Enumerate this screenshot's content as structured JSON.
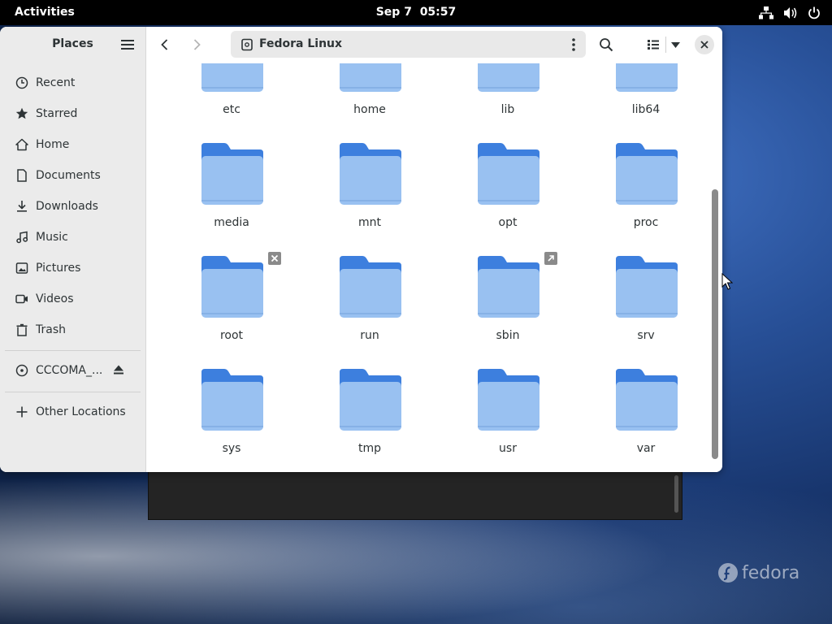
{
  "topbar": {
    "activities": "Activities",
    "date": "Sep 7",
    "time": "05:57",
    "icons": [
      "network-icon",
      "volume-icon",
      "power-icon"
    ]
  },
  "sidebar": {
    "title": "Places",
    "items": [
      {
        "label": "Recent",
        "icon": "clock-icon"
      },
      {
        "label": "Starred",
        "icon": "star-icon"
      },
      {
        "label": "Home",
        "icon": "home-icon"
      },
      {
        "label": "Documents",
        "icon": "document-icon"
      },
      {
        "label": "Downloads",
        "icon": "download-icon"
      },
      {
        "label": "Music",
        "icon": "music-icon"
      },
      {
        "label": "Pictures",
        "icon": "picture-icon"
      },
      {
        "label": "Videos",
        "icon": "video-icon"
      },
      {
        "label": "Trash",
        "icon": "trash-icon"
      }
    ],
    "drive": {
      "label": "CCCOMA_...",
      "icon": "disc-icon"
    },
    "other": {
      "label": "Other Locations",
      "icon": "plus-icon"
    }
  },
  "header": {
    "path": "Fedora Linux"
  },
  "folders": [
    {
      "name": "etc"
    },
    {
      "name": "home"
    },
    {
      "name": "lib"
    },
    {
      "name": "lib64"
    },
    {
      "name": "media"
    },
    {
      "name": "mnt"
    },
    {
      "name": "opt"
    },
    {
      "name": "proc"
    },
    {
      "name": "root",
      "emblem": "no-access-emblem"
    },
    {
      "name": "run"
    },
    {
      "name": "sbin",
      "emblem": "symlink-emblem"
    },
    {
      "name": "srv"
    },
    {
      "name": "sys"
    },
    {
      "name": "tmp"
    },
    {
      "name": "usr"
    },
    {
      "name": "var"
    }
  ],
  "wallpaper": {
    "brand": "fedora"
  },
  "colors": {
    "folder_back": "#3d7fde",
    "folder_front": "#99c1f1",
    "topbar": "#000000"
  }
}
